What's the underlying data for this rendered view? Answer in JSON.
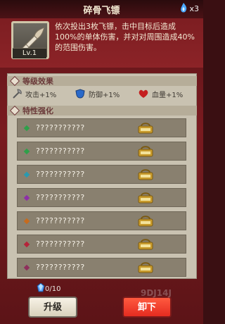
{
  "header": {
    "title": "碎骨飞镖",
    "gem_count": "x3"
  },
  "item": {
    "level_label": "Lv.1",
    "description": "依次投出3枚飞镖，击中目标后造成100%的单体伤害，并对对周围造成40%的范围伤害。"
  },
  "sections": {
    "level_effects": "等级效果",
    "traits": "特性强化"
  },
  "stats": [
    {
      "label": "攻击+1%",
      "icon": "axe-icon",
      "color": "#6b6b6b"
    },
    {
      "label": "防御+1%",
      "icon": "shield-icon",
      "color": "#2a69c9"
    },
    {
      "label": "血量+1%",
      "icon": "heart-icon",
      "color": "#c41f1f"
    }
  ],
  "trait_rows": [
    {
      "text": "???????????",
      "gem_color": "#2fa04a"
    },
    {
      "text": "???????????",
      "gem_color": "#2fa04a"
    },
    {
      "text": "???????????",
      "gem_color": "#2a9ab0"
    },
    {
      "text": "???????????",
      "gem_color": "#8e2fa8"
    },
    {
      "text": "???????????",
      "gem_color": "#c76b1e"
    },
    {
      "text": "???????????",
      "gem_color": "#b6233a"
    },
    {
      "text": "???????????",
      "gem_color": "#8e2f5c"
    }
  ],
  "crystal": {
    "count": "0/10"
  },
  "buttons": {
    "upgrade": "升级",
    "unequip": "卸下"
  },
  "watermark": "9DJ14J"
}
